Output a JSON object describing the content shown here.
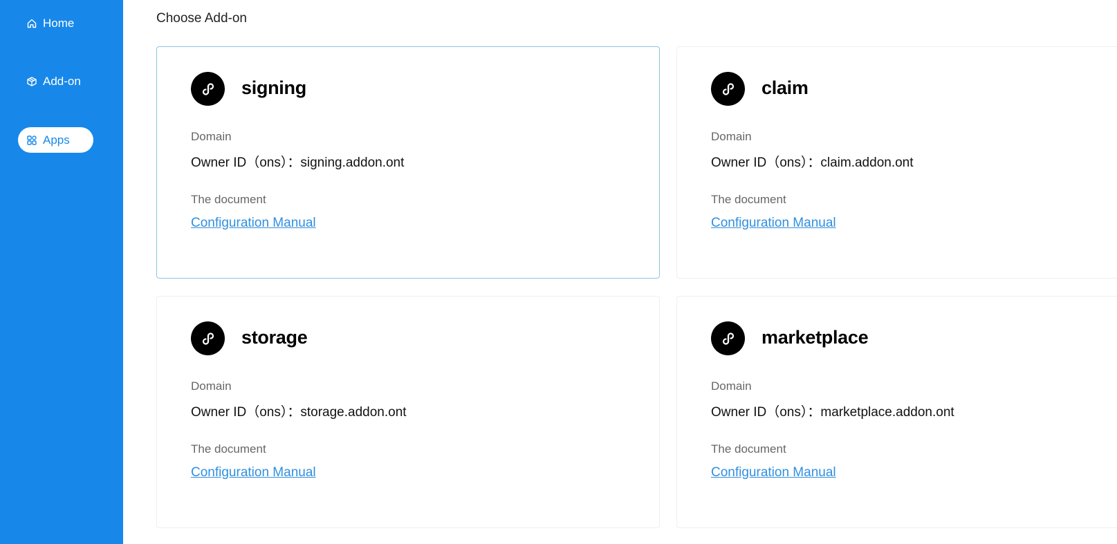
{
  "sidebar": {
    "items": [
      {
        "label": "Home",
        "icon": "home-icon",
        "active": false
      },
      {
        "label": "Add-on",
        "icon": "cube-icon",
        "active": false
      },
      {
        "label": "Apps",
        "icon": "apps-grid-icon",
        "active": true
      }
    ]
  },
  "main": {
    "title": "Choose Add-on",
    "domain_label": "Domain",
    "owner_prefix": "Owner ID（ons）：",
    "document_label": "The document",
    "cards": [
      {
        "name": "signing",
        "owner_id": "signing.addon.ont",
        "doc_link": "Configuration Manual",
        "selected": true
      },
      {
        "name": "claim",
        "owner_id": "claim.addon.ont",
        "doc_link": "Configuration Manual",
        "selected": false
      },
      {
        "name": "storage",
        "owner_id": "storage.addon.ont",
        "doc_link": "Configuration Manual",
        "selected": false
      },
      {
        "name": "marketplace",
        "owner_id": "marketplace.addon.ont",
        "doc_link": "Configuration Manual",
        "selected": false
      }
    ]
  },
  "colors": {
    "sidebar_bg": "#1788ea",
    "link": "#2f8fe0",
    "selected_border": "#8ec3e8",
    "logo_bg": "#000000"
  }
}
